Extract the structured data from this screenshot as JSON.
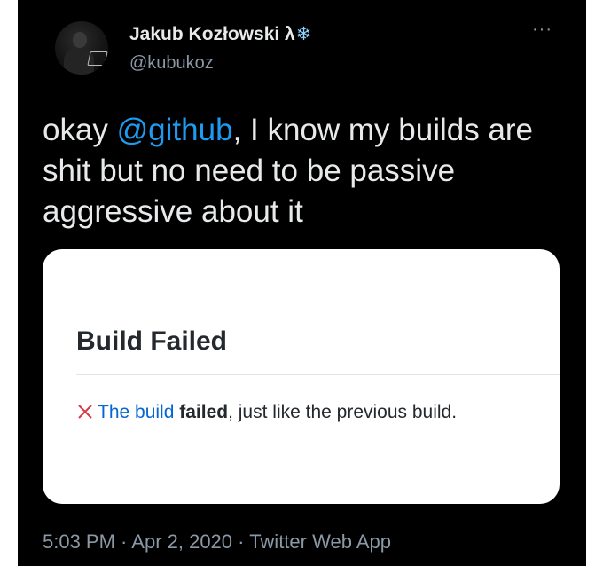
{
  "author": {
    "display_name": "Jakub Kozłowski λ",
    "name_emoji": "❄",
    "handle": "@kubukoz",
    "avatar_icon": "profile-photo"
  },
  "menu": {
    "more_icon": "ellipsis-icon",
    "more_glyph": "···"
  },
  "tweet": {
    "text_before": "okay ",
    "mention": "@github",
    "text_after": ", I know my builds are shit but no need to be passive aggressive about it",
    "mention_color": "#1d9bf0"
  },
  "embedded_image": {
    "title": "Build Failed",
    "status_icon": "x-icon",
    "status_color": "#d73a49",
    "link_text": "The build",
    "bold_text": "failed",
    "rest_text": ", just like the previous build."
  },
  "meta": {
    "time": "5:03 PM",
    "separator": " · ",
    "date": "Apr 2, 2020",
    "app": "Twitter Web App"
  }
}
